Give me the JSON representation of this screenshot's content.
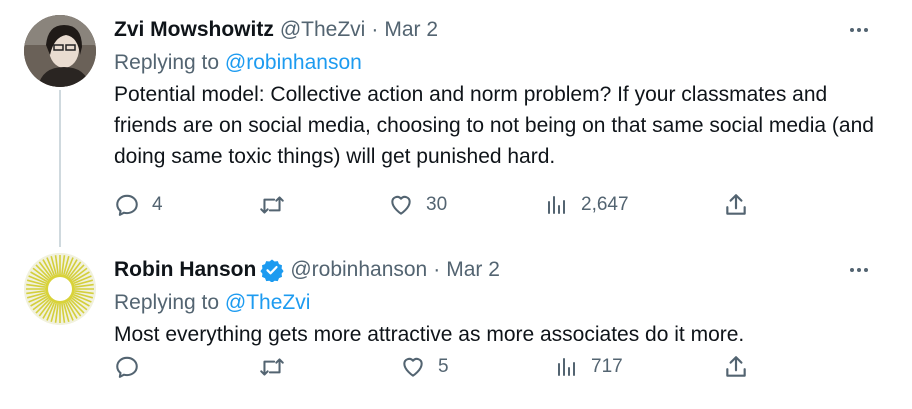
{
  "tweets": [
    {
      "author_name": "Zvi Mowshowitz",
      "handle": "@TheZvi",
      "separator": "·",
      "date": "Mar 2",
      "replying_prefix": "Replying to",
      "replying_to": "@robinhanson",
      "text": "Potential model: Collective action and norm problem? If your classmates and friends are on social media, choosing to not being on that same social media (and doing same toxic things) will get punished hard.",
      "replies": "4",
      "retweets": "",
      "likes": "30",
      "views": "2,647",
      "verified": false
    },
    {
      "author_name": "Robin Hanson",
      "handle": "@robinhanson",
      "separator": "·",
      "date": "Mar 2",
      "replying_prefix": "Replying to",
      "replying_to": "@TheZvi",
      "text": "Most everything gets more attractive as more associates do it more.",
      "replies": "",
      "retweets": "",
      "likes": "5",
      "views": "717",
      "verified": true
    }
  ],
  "icons": [
    "reply-icon",
    "retweet-icon",
    "like-icon",
    "views-icon",
    "share-icon",
    "more-icon",
    "verified-icon"
  ],
  "colors": {
    "text": "#0f1419",
    "secondary": "#536471",
    "link": "#1d9bf0",
    "thread_line": "#cfd9de"
  }
}
